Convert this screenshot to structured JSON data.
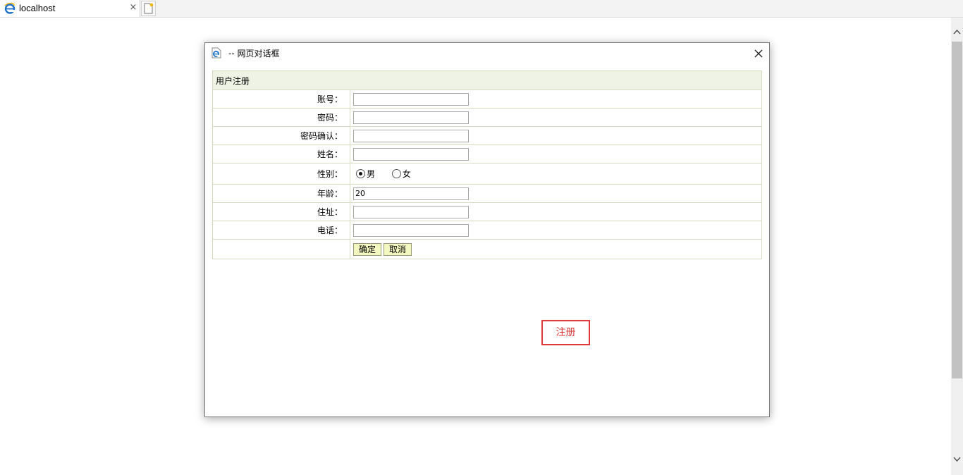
{
  "browser": {
    "tab_title": "localhost",
    "tab_close": "×"
  },
  "dialog": {
    "title": "-- 网页对话框",
    "form": {
      "header": "用户注册",
      "fields": {
        "account": {
          "label": "账号：",
          "value": ""
        },
        "password": {
          "label": "密码：",
          "value": ""
        },
        "password_confirm": {
          "label": "密码确认：",
          "value": ""
        },
        "name": {
          "label": "姓名：",
          "value": ""
        },
        "gender": {
          "label": "性别：",
          "options": [
            "男",
            "女"
          ],
          "selected": "男"
        },
        "age": {
          "label": "年龄：",
          "value": "20"
        },
        "address": {
          "label": "住址：",
          "value": ""
        },
        "phone": {
          "label": "电话：",
          "value": ""
        }
      },
      "buttons": {
        "confirm": "确定",
        "cancel": "取消"
      }
    },
    "annotation": "注册"
  },
  "colors": {
    "header_bg": "#eef3e5",
    "border": "#d6dcc4",
    "button_bg": "#f3f7c0",
    "annotation": "#e03a3a"
  }
}
